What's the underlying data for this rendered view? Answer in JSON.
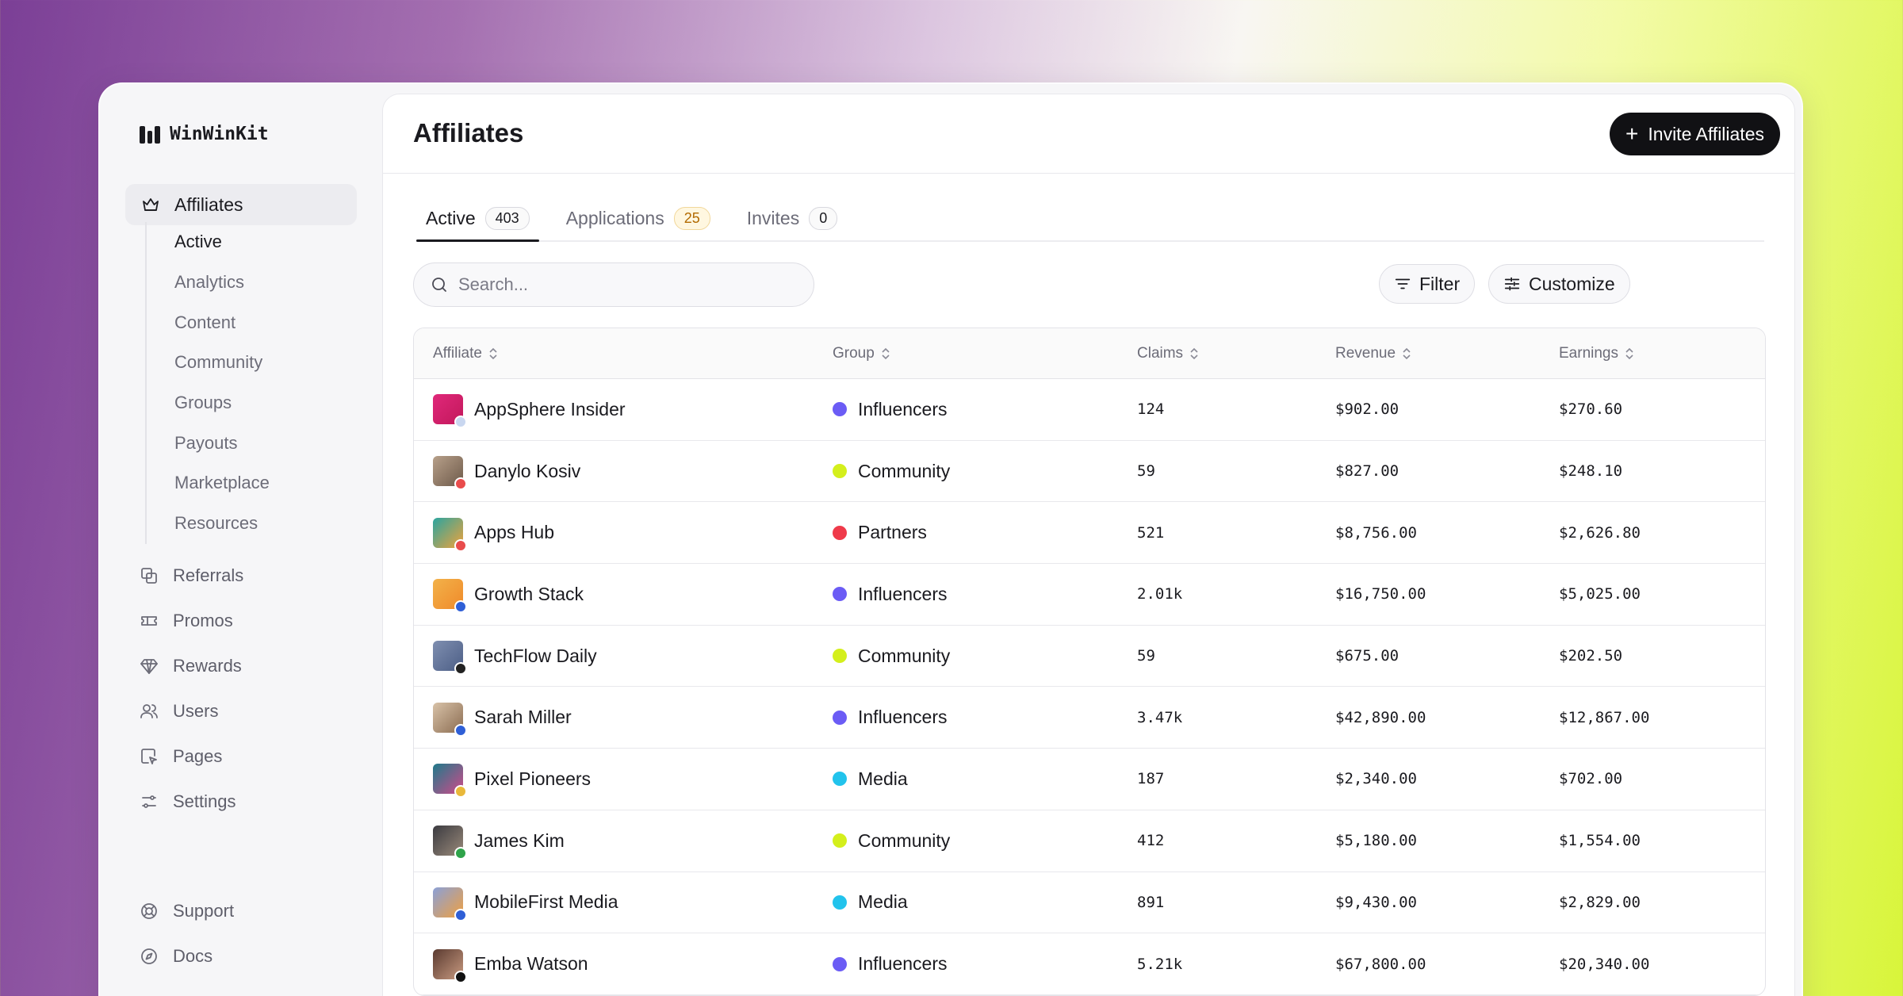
{
  "brand": {
    "name": "WinWinKit"
  },
  "sidebar": {
    "primary": {
      "label": "Affiliates",
      "icon": "crown-icon"
    },
    "sub_items": [
      {
        "label": "Active",
        "active": true
      },
      {
        "label": "Analytics"
      },
      {
        "label": "Content"
      },
      {
        "label": "Community"
      },
      {
        "label": "Groups"
      },
      {
        "label": "Payouts"
      },
      {
        "label": "Marketplace"
      },
      {
        "label": "Resources"
      }
    ],
    "items": [
      {
        "label": "Referrals",
        "icon": "referrals-icon"
      },
      {
        "label": "Promos",
        "icon": "ticket-icon"
      },
      {
        "label": "Rewards",
        "icon": "diamond-icon"
      },
      {
        "label": "Users",
        "icon": "users-icon"
      },
      {
        "label": "Pages",
        "icon": "page-cursor-icon"
      },
      {
        "label": "Settings",
        "icon": "sliders-icon"
      }
    ],
    "footer": [
      {
        "label": "Support",
        "icon": "lifebuoy-icon"
      },
      {
        "label": "Docs",
        "icon": "compass-icon"
      }
    ]
  },
  "header": {
    "title": "Affiliates",
    "invite_label": "Invite Affiliates"
  },
  "tabs": [
    {
      "label": "Active",
      "count": "403",
      "active": true
    },
    {
      "label": "Applications",
      "count": "25"
    },
    {
      "label": "Invites",
      "count": "0"
    }
  ],
  "search": {
    "placeholder": "Search..."
  },
  "toolbar": {
    "filter_label": "Filter",
    "customize_label": "Customize"
  },
  "table": {
    "columns": [
      "Affiliate",
      "Group",
      "Claims",
      "Revenue",
      "Earnings"
    ],
    "rows": [
      {
        "name": "AppSphere Insider",
        "group": "Influencers",
        "claims": "124",
        "revenue": "$902.00",
        "earnings": "$270.60"
      },
      {
        "name": "Danylo Kosiv",
        "group": "Community",
        "claims": "59",
        "revenue": "$827.00",
        "earnings": "$248.10"
      },
      {
        "name": "Apps Hub",
        "group": "Partners",
        "claims": "521",
        "revenue": "$8,756.00",
        "earnings": "$2,626.80"
      },
      {
        "name": "Growth Stack",
        "group": "Influencers",
        "claims": "2.01k",
        "revenue": "$16,750.00",
        "earnings": "$5,025.00"
      },
      {
        "name": "TechFlow Daily",
        "group": "Community",
        "claims": "59",
        "revenue": "$675.00",
        "earnings": "$202.50"
      },
      {
        "name": "Sarah Miller",
        "group": "Influencers",
        "claims": "3.47k",
        "revenue": "$42,890.00",
        "earnings": "$12,867.00"
      },
      {
        "name": "Pixel Pioneers",
        "group": "Media",
        "claims": "187",
        "revenue": "$2,340.00",
        "earnings": "$702.00"
      },
      {
        "name": "James Kim",
        "group": "Community",
        "claims": "412",
        "revenue": "$5,180.00",
        "earnings": "$1,554.00"
      },
      {
        "name": "MobileFirst Media",
        "group": "Media",
        "claims": "891",
        "revenue": "$9,430.00",
        "earnings": "$2,829.00"
      },
      {
        "name": "Emba Watson",
        "group": "Influencers",
        "claims": "5.21k",
        "revenue": "$67,800.00",
        "earnings": "$20,340.00"
      }
    ]
  },
  "colors": {
    "Influencers": "#6b5cf5",
    "Community": "#d4ef1c",
    "Partners": "#ef3a4a",
    "Media": "#22c3ec"
  }
}
